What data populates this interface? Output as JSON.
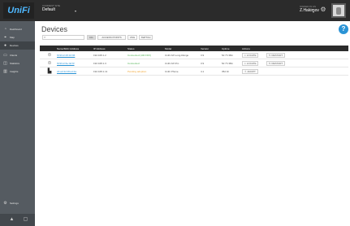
{
  "app": {
    "logo_text": "UniFi",
    "site_caption": "CURRENT SITE",
    "site_name": "Default",
    "admin_caption": "SIGNED IN AS",
    "admin_name": "Z.Hakimov"
  },
  "icons": {
    "caret": "▾",
    "settings": "⚙",
    "search": "⌕",
    "help": "?",
    "locate": "⌖",
    "restart": "↻",
    "upgrade": "⇧"
  },
  "sidebar": {
    "items": [
      {
        "label": "Dashboard",
        "icon": "◔"
      },
      {
        "label": "Map",
        "icon": "⌖"
      },
      {
        "label": "Devices",
        "icon": "●"
      },
      {
        "label": "Clients",
        "icon": "▭"
      },
      {
        "label": "Statistics",
        "icon": "◫"
      },
      {
        "label": "Insights",
        "icon": "▥"
      }
    ],
    "bottom_item": {
      "label": "Settings",
      "icon": "⚙"
    },
    "footer_icons": [
      "▲",
      "▢"
    ]
  },
  "page": {
    "title": "Devices",
    "search_placeholder": "",
    "filters": [
      "ALL",
      "ACCESS POINTS",
      "USG",
      "SWITCH"
    ]
  },
  "table": {
    "columns": [
      "Name/MAC Address",
      "IP Address",
      "Status",
      "Model",
      "Version",
      "Uptime",
      "Actions"
    ],
    "rows": [
      {
        "name": "f0:9f:c2:25:16:96",
        "ip": "192.168.1.2",
        "status": "Connected (100 FDX)",
        "status_color": "#4caf50",
        "model": "UniFi AP-Long-Range",
        "version": "3.9",
        "uptime": "5d 7h 38m",
        "actions": [
          "LOCATE",
          "RESTART"
        ],
        "icon": "⊜"
      },
      {
        "name": "f0:9f:c2:6e:4d:6f",
        "ip": "192.168.1.3",
        "status": "Connected",
        "status_color": "#4caf50",
        "model": "UniFi AP-Pro",
        "version": "3.9",
        "uptime": "5d 7h 38m",
        "actions": [
          "LOCATE",
          "RESTART"
        ],
        "icon": "⊜"
      },
      {
        "name": "24:a4:3c:b8:ed:2a",
        "ip": "192.168.1.11",
        "status": "Pending adoption",
        "status_color": "#f0a431",
        "model": "UniFi Phone",
        "version": "4.1",
        "uptime": "35d 1h",
        "actions": [
          "ADOPT"
        ],
        "icon": "▙"
      }
    ]
  }
}
